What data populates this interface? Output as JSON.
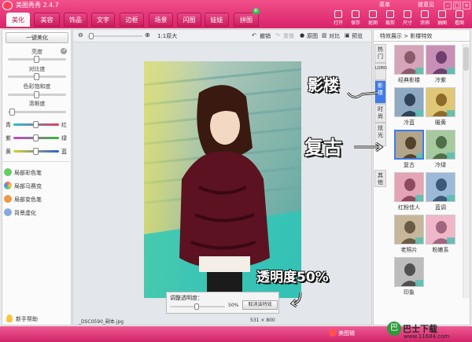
{
  "app": {
    "title": "美图秀秀 2.4.7",
    "menu": "菜单",
    "advice": "提意见"
  },
  "tabs": [
    {
      "label": "美化",
      "active": true
    },
    {
      "label": "美容"
    },
    {
      "label": "饰品"
    },
    {
      "label": "文字"
    },
    {
      "label": "边框"
    },
    {
      "label": "场景"
    },
    {
      "label": "闪图"
    },
    {
      "label": "娃娃"
    },
    {
      "label": "拼图",
      "badge": "新"
    }
  ],
  "tools": [
    "打开",
    "保存",
    "抠图",
    "裁剪",
    "尺寸",
    "涂鸦",
    "抽图",
    "看图"
  ],
  "left": {
    "onekey": "一键美化",
    "sliders": [
      {
        "label": "亮度",
        "value": 0.5
      },
      {
        "label": "对比度",
        "value": 0.5
      },
      {
        "label": "色彩饱和度",
        "value": 0.5
      },
      {
        "label": "清晰度",
        "value": 0.08
      }
    ],
    "color_sliders": [
      {
        "left": "青",
        "right": "红",
        "value": 0.5
      },
      {
        "left": "紫",
        "right": "绿",
        "value": 0.5
      },
      {
        "left": "黄",
        "right": "蓝",
        "value": 0.5
      }
    ],
    "tools": [
      "局部彩色笔",
      "局部马赛克",
      "局部变色笔",
      "背景虚化"
    ],
    "help": "新手帮助"
  },
  "center": {
    "zoom": "1:1原大",
    "undo": "撤销",
    "redo": "重做",
    "original": "原图",
    "compare": "对比",
    "preview": "预览",
    "filename": "_DSC0590_副本.jpg",
    "dims": "531 × 800",
    "dialog": {
      "title": "调整透明度：",
      "value": "50%",
      "button": "取消该特效",
      "level": 0.5
    }
  },
  "right": {
    "breadcrumb": "特效展示 > 影楼特效",
    "vtabs": [
      "热门",
      "LOMO",
      "影楼",
      "时尚",
      "炫光",
      "其他"
    ],
    "thumbs": [
      "经典影楼",
      "冷紫",
      "冷蓝",
      "暖黄",
      "复古",
      "冷绿",
      "红粉佳人",
      "蓝调",
      "老照片",
      "粉嫩系",
      "印象"
    ]
  },
  "annotations": {
    "studio": "影楼",
    "retro": "复古",
    "opacity": "透明度50%"
  },
  "status": {
    "watermark": "www.11684.com",
    "brand": "巴士下载",
    "share": "美图微"
  }
}
